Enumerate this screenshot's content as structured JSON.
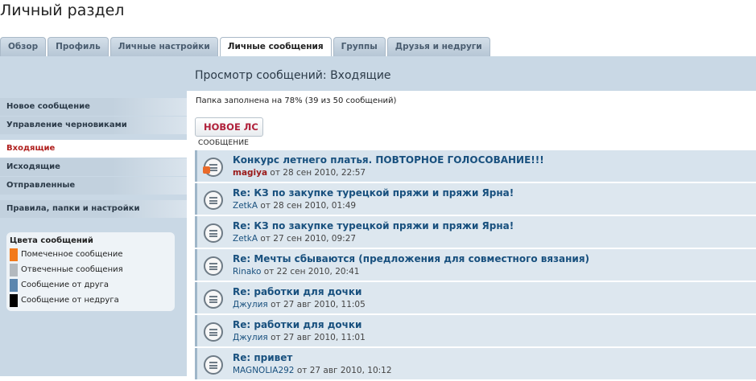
{
  "page": {
    "title": "Личный раздел"
  },
  "tabs": [
    {
      "label": "Обзор",
      "active": false
    },
    {
      "label": "Профиль",
      "active": false
    },
    {
      "label": "Личные настройки",
      "active": false
    },
    {
      "label": "Личные сообщения",
      "active": true
    },
    {
      "label": "Группы",
      "active": false
    },
    {
      "label": "Друзья и недруги",
      "active": false
    }
  ],
  "content": {
    "title": "Просмотр сообщений: Входящие",
    "folder_status": "Папка заполнена на 78% (39 из 50 сообщений)",
    "new_pm_label": "НОВОЕ ЛС",
    "column_header": "СООБЩЕНИЕ"
  },
  "sidebar": {
    "items": [
      {
        "label": "Новое сообщение",
        "active": false
      },
      {
        "label": "Управление черновиками",
        "active": false
      },
      {
        "label": "Входящие",
        "active": true
      },
      {
        "label": "Исходящие",
        "active": false
      },
      {
        "label": "Отправленные",
        "active": false
      },
      {
        "label": "Правила, папки и настройки",
        "active": false
      }
    ],
    "legend": {
      "title": "Цвета сообщений",
      "items": [
        {
          "label": "Помеченное сообщение",
          "color": "#f27a1b"
        },
        {
          "label": "Отвеченные сообщения",
          "color": "#b3b9be"
        },
        {
          "label": "Сообщение от друга",
          "color": "#5b86ae"
        },
        {
          "label": "Сообщение от недруга",
          "color": "#000000"
        }
      ]
    }
  },
  "messages": [
    {
      "subject": "Конкурс летнего платья. ПОВТОРНОЕ ГОЛОСОВАНИЕ!!!",
      "author": "magiya",
      "date": "от 28 сен 2010, 22:57",
      "flagged": true
    },
    {
      "subject": "Re: КЗ по закупке турецкой пряжи и пряжи Ярна!",
      "author": "ZetkA",
      "date": "от 28 сен 2010, 01:49",
      "flagged": false
    },
    {
      "subject": "Re: КЗ по закупке турецкой пряжи и пряжи Ярна!",
      "author": "ZetkA",
      "date": "от 27 сен 2010, 09:27",
      "flagged": false
    },
    {
      "subject": "Re: Мечты сбываются (предложения для совместного вязания)",
      "author": "Rinako",
      "date": "от 22 сен 2010, 20:41",
      "flagged": false
    },
    {
      "subject": "Re: работки для дочки",
      "author": "Джулия",
      "date": "от 27 авг 2010, 11:05",
      "flagged": false
    },
    {
      "subject": "Re: работки для дочки",
      "author": "Джулия",
      "date": "от 27 авг 2010, 11:01",
      "flagged": false
    },
    {
      "subject": "Re: привет",
      "author": "MAGNOLIA292",
      "date": "от 27 авг 2010, 10:12",
      "flagged": false
    }
  ]
}
